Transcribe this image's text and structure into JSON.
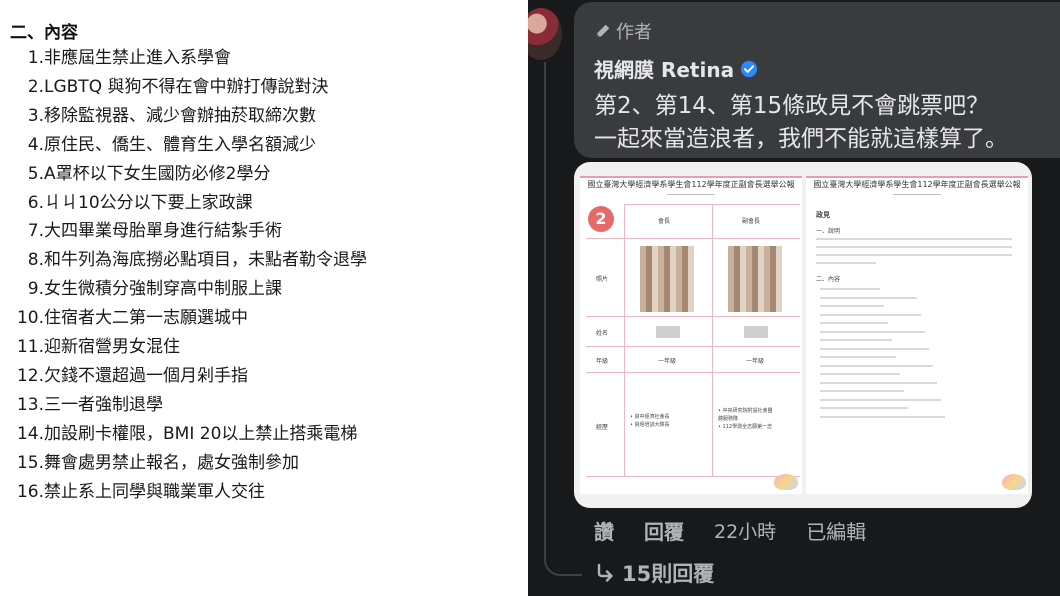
{
  "document": {
    "heading": "二、內容",
    "items": [
      {
        "num": "1.",
        "text": "非應屆生禁止進入系學會"
      },
      {
        "num": "2.",
        "text": "LGBTQ 與狗不得在會中辦打傳說對決"
      },
      {
        "num": "3.",
        "text": "移除監視器、減少會辦抽菸取締次數"
      },
      {
        "num": "4.",
        "text": "原住民、僑生、體育生入學名額減少"
      },
      {
        "num": "5.",
        "text": "A罩杯以下女生國防必修2學分"
      },
      {
        "num": "6.",
        "text": "ㄐㄐ10公分以下要上家政課"
      },
      {
        "num": "7.",
        "text": "大四畢業母胎單身進行結紮手術"
      },
      {
        "num": "8.",
        "text": "和牛列為海底撈必點項目，未點者勒令退學"
      },
      {
        "num": "9.",
        "text": "女生微積分強制穿高中制服上課"
      },
      {
        "num": "10.",
        "text": "住宿者大二第一志願選城中"
      },
      {
        "num": "11.",
        "text": "迎新宿營男女混住"
      },
      {
        "num": "12.",
        "text": "欠錢不還超過一個月剁手指"
      },
      {
        "num": "13.",
        "text": "三一者強制退學"
      },
      {
        "num": "14.",
        "text": "加設刷卡權限，BMI 20以上禁止搭乘電梯"
      },
      {
        "num": "15.",
        "text": "舞會處男禁止報名，處女強制參加"
      },
      {
        "num": "16.",
        "text": "禁止系上同學與職業軍人交往"
      }
    ]
  },
  "comment": {
    "author_badge": "作者",
    "name": "視網膜 Retina",
    "line1": "第2、第14、第15條政見不會跳票吧？",
    "line2": "一起來當造浪者，我們不能就這樣算了。",
    "attachment": {
      "page_a_title": "國立臺灣大學經濟學系學生會112學年度正副會長選舉公報",
      "page_b_title": "國立臺灣大學經濟學系學生會112學年度正副會長選舉公報",
      "number": "2",
      "col_chair": "會長",
      "col_vice": "副會長",
      "row_photo": "照片",
      "row_name": "姓名",
      "row_grade": "年級",
      "row_exp": "經歷",
      "grade_chair": "一年級",
      "grade_vice": "一年級",
      "exp_chair": [
        "• 資中經濟社會長",
        "• 資經培訓大隊長"
      ],
      "exp_vice": [
        "• 中央研究院附設社會團",
        "  體服務隊",
        "• 112學測全志願第一志"
      ],
      "policy_title": "政見",
      "sec1": "一、說明",
      "sec2": "二、內容"
    },
    "actions": {
      "like": "讚",
      "reply": "回覆",
      "time": "22小時",
      "edited": "已編輯"
    },
    "replies_label": "15則回覆"
  },
  "colors": {
    "panel_bg": "#18191a",
    "bubble_bg": "#3a3b3c",
    "text_primary": "#e4e6eb",
    "text_secondary": "#b0b3b8",
    "verified_blue": "#2d88ff",
    "accent_pink": "#e66a6a"
  }
}
